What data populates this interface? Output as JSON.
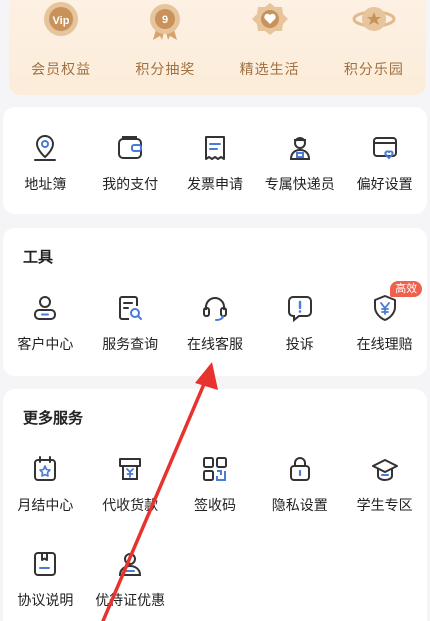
{
  "vip": {
    "items": [
      {
        "label": "会员权益",
        "badge_text": "Vip"
      },
      {
        "label": "积分抽奖",
        "badge_text": "9"
      },
      {
        "label": "精选生活",
        "badge_text": ""
      },
      {
        "label": "积分乐园",
        "badge_text": ""
      }
    ]
  },
  "quick": {
    "items": [
      {
        "label": "地址簿",
        "icon": "location-pin-icon"
      },
      {
        "label": "我的支付",
        "icon": "wallet-icon"
      },
      {
        "label": "发票申请",
        "icon": "receipt-icon"
      },
      {
        "label": "专属快递员",
        "icon": "courier-icon"
      },
      {
        "label": "偏好设置",
        "icon": "preference-card-icon"
      }
    ]
  },
  "tools": {
    "title": "工具",
    "items": [
      {
        "label": "客户中心",
        "icon": "user-icon"
      },
      {
        "label": "服务查询",
        "icon": "search-document-icon"
      },
      {
        "label": "在线客服",
        "icon": "headset-icon"
      },
      {
        "label": "投诉",
        "icon": "alert-bubble-icon"
      },
      {
        "label": "在线理赔",
        "icon": "yen-shield-icon",
        "badge": "高效"
      }
    ]
  },
  "more": {
    "title": "更多服务",
    "items": [
      {
        "label": "月结中心",
        "icon": "calendar-star-icon"
      },
      {
        "label": "代收货款",
        "icon": "yen-box-icon"
      },
      {
        "label": "签收码",
        "icon": "qr-code-icon"
      },
      {
        "label": "隐私设置",
        "icon": "lock-icon"
      },
      {
        "label": "学生专区",
        "icon": "graduation-cap-icon"
      },
      {
        "label": "协议说明",
        "icon": "document-icon"
      },
      {
        "label": "优待证优惠",
        "icon": "person-badge-icon"
      }
    ]
  },
  "colors": {
    "gold": "#a0703f",
    "badge_red": "#f0614d",
    "annotation_arrow": "#e8322e"
  }
}
